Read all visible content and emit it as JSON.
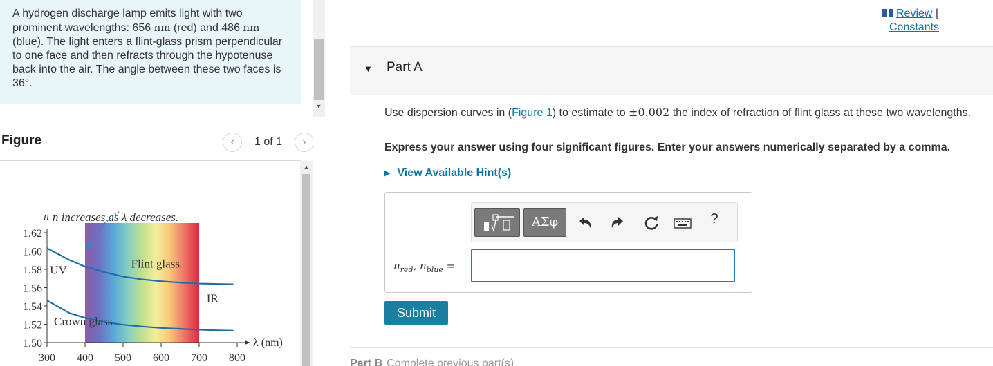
{
  "problem": {
    "text_1": "A hydrogen discharge lamp emits light with two prominent wavelengths: 656 ",
    "unit_nm": "nm",
    "text_2": " (red) and 486 ",
    "text_3": " (blue). The light enters a flint-glass prism perpendicular to one face and then refracts through the hypotenuse back into the air. The angle between these two faces is 36°."
  },
  "figure": {
    "title": "Figure",
    "page_label": "1 of 1",
    "prev_symbol": "‹",
    "next_symbol": "›"
  },
  "chart_data": {
    "type": "line",
    "title": "",
    "xlabel": "λ (nm)",
    "ylabel": "n",
    "xlim": [
      300,
      800
    ],
    "ylim": [
      1.5,
      1.62
    ],
    "x_ticks": [
      300,
      400,
      500,
      600,
      700,
      800
    ],
    "y_ticks": [
      "1.50",
      "1.52",
      "1.54",
      "1.56",
      "1.58",
      "1.60",
      "1.62"
    ],
    "visible_spectrum": [
      400,
      700
    ],
    "series": [
      {
        "name": "Flint glass",
        "x": [
          300,
          360,
          400,
          450,
          500,
          550,
          600,
          650,
          700,
          750,
          790
        ],
        "y": [
          1.603,
          1.59,
          1.583,
          1.577,
          1.572,
          1.569,
          1.567,
          1.5655,
          1.5645,
          1.564,
          1.5637
        ]
      },
      {
        "name": "Crown glass",
        "x": [
          300,
          360,
          400,
          450,
          500,
          550,
          600,
          650,
          700,
          750,
          790
        ],
        "y": [
          1.546,
          1.532,
          1.527,
          1.5225,
          1.5195,
          1.5175,
          1.516,
          1.515,
          1.514,
          1.5133,
          1.513
        ]
      }
    ],
    "annotations": [
      {
        "text": "n increases as λ decreases.",
        "x": 480,
        "y": 1.633
      },
      {
        "text": "UV",
        "x": 330,
        "y": 1.575
      },
      {
        "text": "IR",
        "x": 735,
        "y": 1.544
      },
      {
        "text": "Flint glass",
        "x": 585,
        "y": 1.582
      },
      {
        "text": "Crown glass",
        "x": 395,
        "y": 1.519
      }
    ],
    "colors": {
      "curve": "#1e6ea7",
      "axis": "#333333",
      "arrow": "#3b84c4"
    }
  },
  "header": {
    "review_label": "Review",
    "separator": "|",
    "constants_label": "Constants"
  },
  "part_a": {
    "title": "Part A",
    "question_1": "Use dispersion curves in (",
    "figure_link": "Figure 1",
    "question_2": ") to estimate to ",
    "tolerance": "±0.002",
    "question_3": " the index of refraction of flint glass at these two wavelengths.",
    "instruction": "Express your answer using four significant figures. Enter your answers numerically separated by a comma.",
    "hint_label": "View Available Hint(s)",
    "symbols_label": "ΑΣφ",
    "help_label": "?",
    "answer_var_1": "n",
    "answer_sub_1": "red",
    "answer_comma": ", ",
    "answer_var_2": "n",
    "answer_sub_2": "blue",
    "answer_equals": " =",
    "answer_value": "",
    "submit_label": "Submit"
  },
  "part_b": {
    "title": "Part B",
    "status": "Complete previous part(s)"
  }
}
